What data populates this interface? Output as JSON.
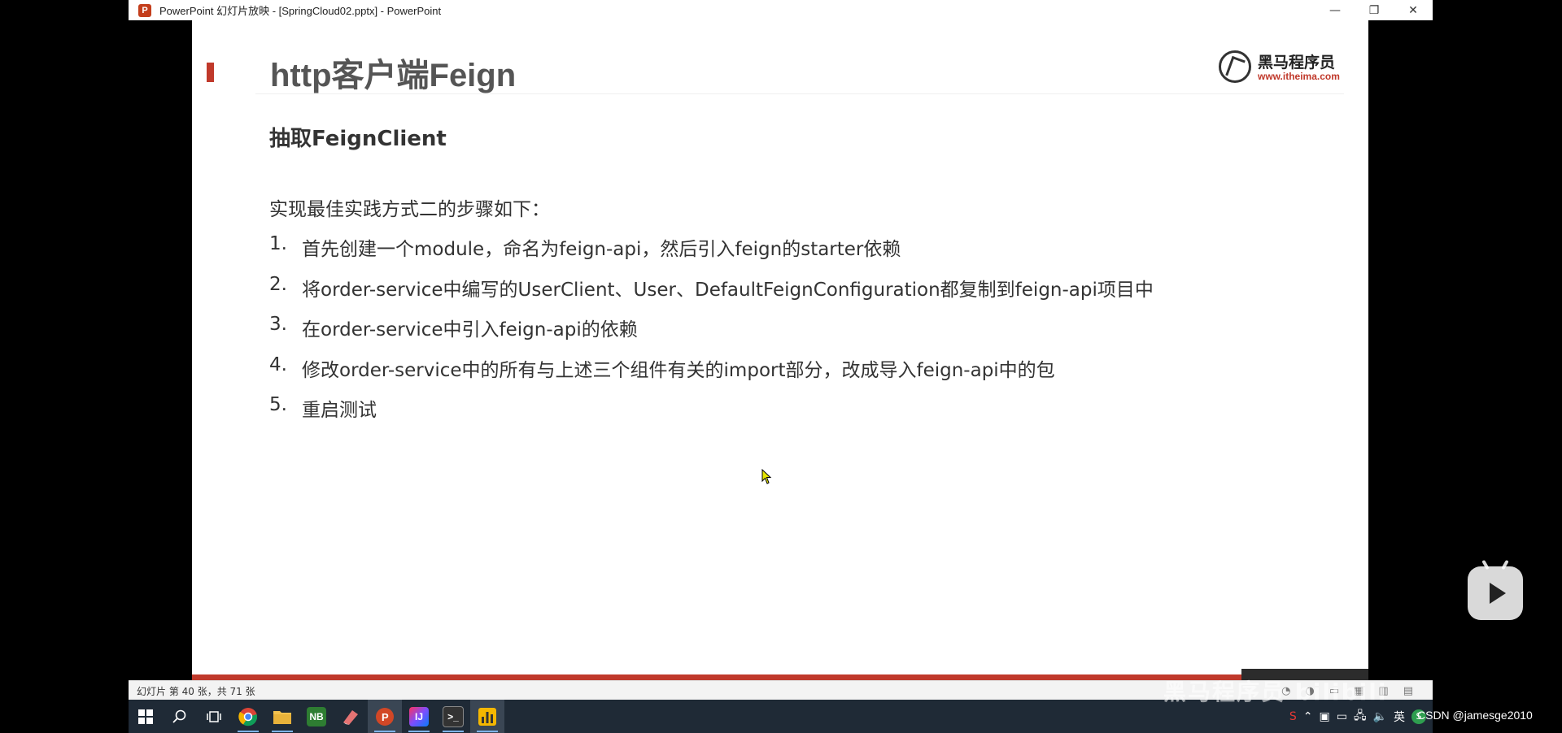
{
  "window": {
    "title": "PowerPoint 幻灯片放映 - [SpringCloud02.pptx] - PowerPoint",
    "app_icon": "P",
    "controls": [
      "—",
      "❐",
      "✕"
    ]
  },
  "slide": {
    "title": "http客户端Feign",
    "logo": {
      "cn": "黑马程序员",
      "url": "www.itheima.com"
    },
    "subtitle": "抽取FeignClient",
    "intro": "实现最佳实践方式二的步骤如下：",
    "steps": [
      {
        "num": "1.",
        "text": "首先创建一个module，命名为feign-api，然后引入feign的starter依赖"
      },
      {
        "num": "2.",
        "text": "将order-service中编写的UserClient、User、DefaultFeignConfiguration都复制到feign-api项目中"
      },
      {
        "num": "3.",
        "text": "在order-service中引入feign-api的依赖"
      },
      {
        "num": "4.",
        "text": "修改order-service中的所有与上述三个组件有关的import部分，改成导入feign-api中的包"
      },
      {
        "num": "5.",
        "text": "重启测试"
      }
    ],
    "accent_color": "#c0392b"
  },
  "statusbar": {
    "text": "幻灯片 第 40 张，共 71 张"
  },
  "taskbar": {
    "tray_ime": "英",
    "tray_s": "S"
  },
  "overlay": {
    "watermark": "黑马程序员 bilibili",
    "csdn": "CSDN @jamesge2010"
  }
}
